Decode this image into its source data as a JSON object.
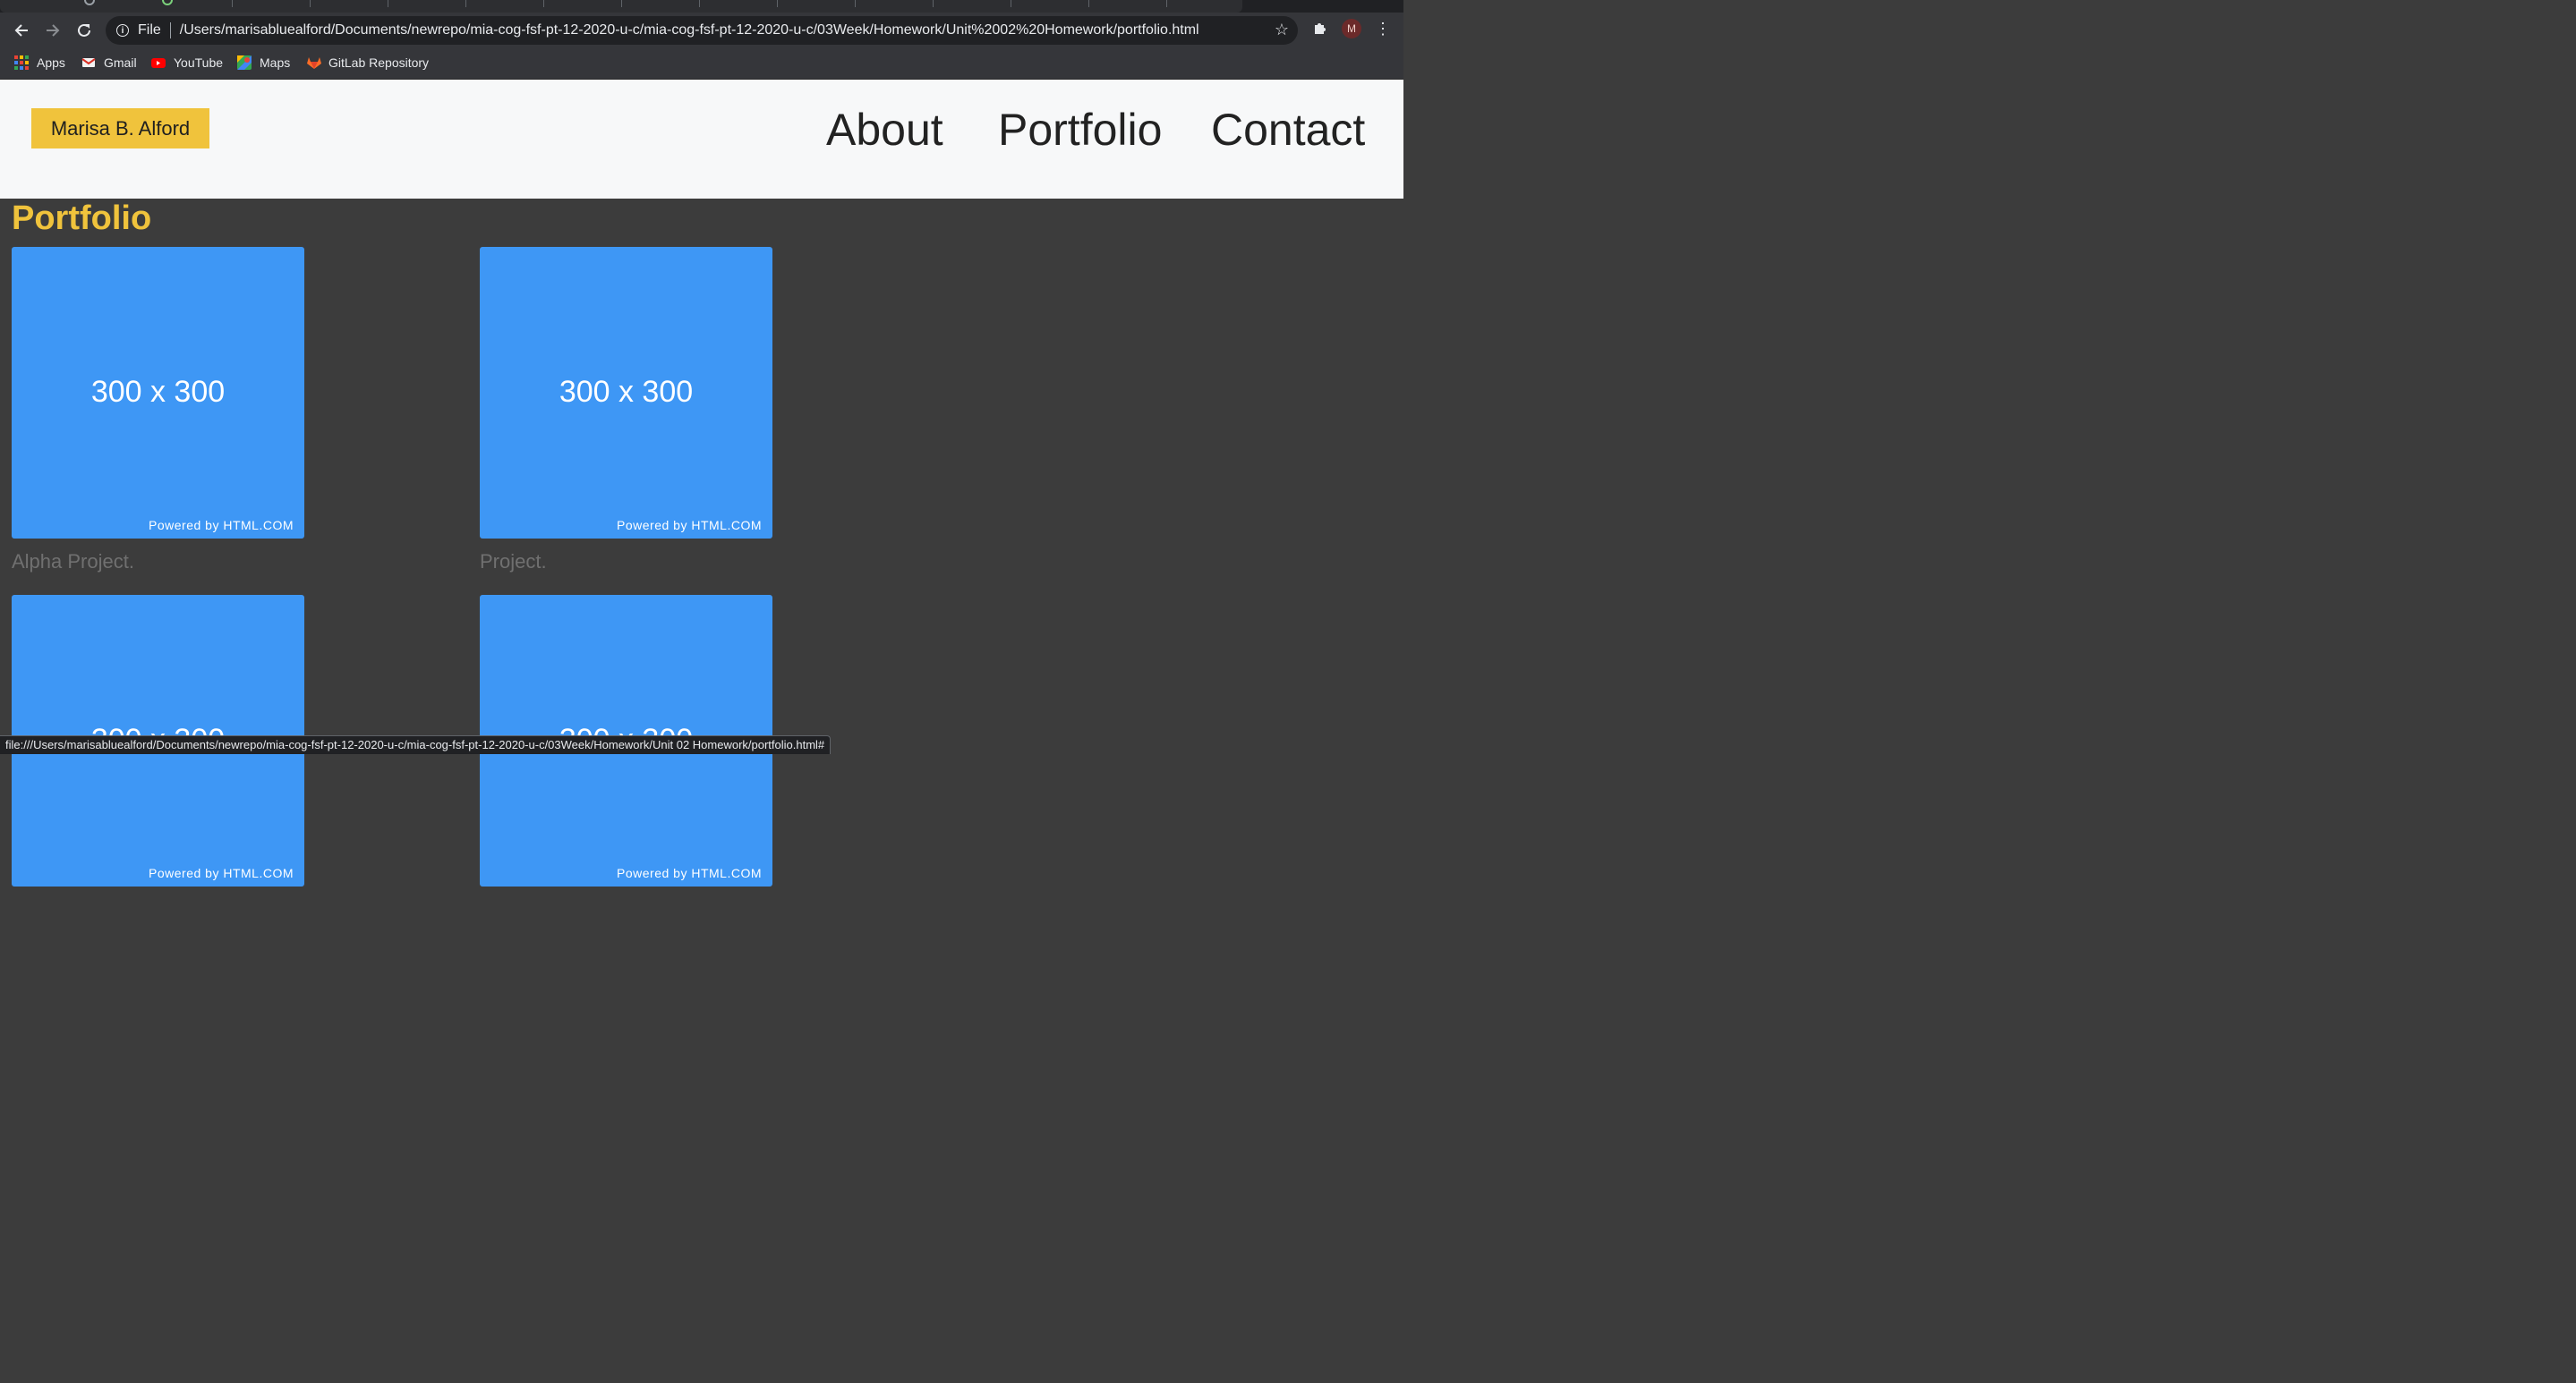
{
  "browser": {
    "address_scheme": "File",
    "address_url": "/Users/marisabluealford/Documents/newrepo/mia-cog-fsf-pt-12-2020-u-c/mia-cog-fsf-pt-12-2020-u-c/03Week/Homework/Unit%2002%20Homework/portfolio.html",
    "profile_initial": "M",
    "bookmarks": [
      {
        "label": "Apps",
        "icon": "apps-grid-icon"
      },
      {
        "label": "Gmail",
        "icon": "gmail-icon"
      },
      {
        "label": "YouTube",
        "icon": "youtube-icon"
      },
      {
        "label": "Maps",
        "icon": "maps-icon"
      },
      {
        "label": "GitLab Repository",
        "icon": "gitlab-icon"
      }
    ],
    "status_url": "file:///Users/marisabluealford/Documents/newrepo/mia-cog-fsf-pt-12-2020-u-c/mia-cog-fsf-pt-12-2020-u-c/03Week/Homework/Unit 02 Homework/portfolio.html#"
  },
  "header": {
    "brand": "Marisa B. Alford",
    "nav": [
      "About",
      "Portfolio",
      "Contact"
    ]
  },
  "main": {
    "title": "Portfolio",
    "projects": [
      {
        "image_text": "300 x 300",
        "powered_by": "Powered by HTML.COM",
        "caption": "Alpha Project."
      },
      {
        "image_text": "300 x 300",
        "powered_by": "Powered by HTML.COM",
        "caption": "Project."
      },
      {
        "image_text": "300 x 300",
        "powered_by": "Powered by HTML.COM",
        "caption": ""
      },
      {
        "image_text": "300 x 300",
        "powered_by": "Powered by HTML.COM",
        "caption": ""
      }
    ]
  },
  "colors": {
    "accent_yellow": "#f0c33c",
    "placeholder_blue": "#3e97f5",
    "page_background": "#3c3c3c",
    "header_background": "#f7f8f9"
  }
}
